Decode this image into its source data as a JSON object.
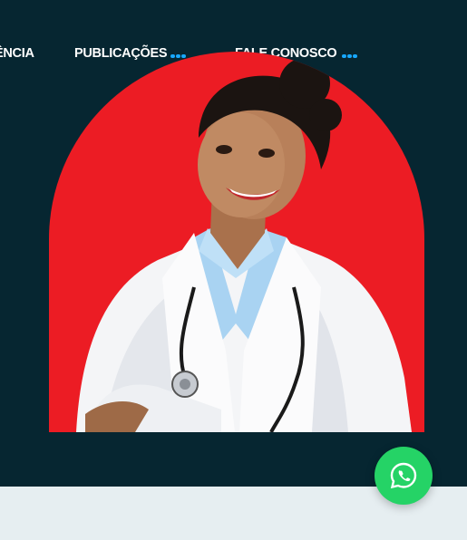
{
  "nav": {
    "items": [
      {
        "label": "ÊNCIA",
        "has_submenu": false
      },
      {
        "label": "PUBLICAÇÕES",
        "has_submenu": true
      },
      {
        "label": "FALE CONOSCO",
        "has_submenu": true
      }
    ]
  },
  "hero": {
    "arch_color": "#ec1c24",
    "background_color": "#062631",
    "image_subject": "doctor-portrait"
  },
  "whatsapp": {
    "icon": "whatsapp-icon",
    "color": "#25d366"
  },
  "colors": {
    "accent": "#17a8ff",
    "lower_section": "#e6eef1"
  }
}
